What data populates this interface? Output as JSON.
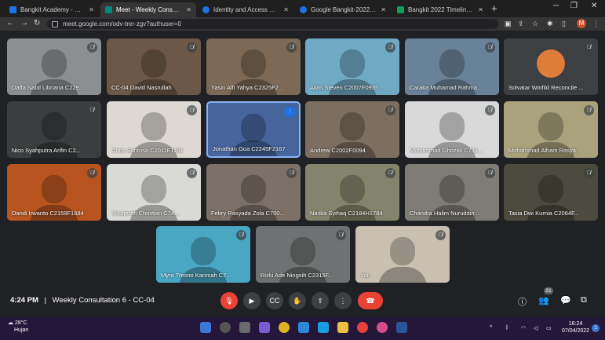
{
  "browser": {
    "tabs": [
      {
        "label": "Bangkit Academy - Calendar",
        "color": "#1a73e8",
        "active": false
      },
      {
        "label": "Meet - Weekly Consultation",
        "color": "#00897b",
        "active": true
      },
      {
        "label": "Identity and Access Manag...",
        "color": "#1a73e8",
        "active": false
      },
      {
        "label": "Google Bangkit-2022 | Cours",
        "color": "#1a73e8",
        "active": false
      },
      {
        "label": "Bangkit 2022 Timeline - Goo",
        "color": "#0f9d58",
        "active": false
      }
    ],
    "new_tab": "+",
    "url": "meet.google.com/odv-trer-zgv?authuser=0",
    "profile_initial": "M"
  },
  "participants": [
    {
      "name": "Daffa Nabil Libriana C229...",
      "bg": "#8c8f92"
    },
    {
      "name": "CC-04 David Nasrullah",
      "bg": "#6c5848"
    },
    {
      "name": "Yasin Alfi Yahya C2325F2...",
      "bg": "#7d6a56"
    },
    {
      "name": "Alvin Steven C2007F0935",
      "bg": "#6fa9c4"
    },
    {
      "name": "Caraka Muhamad Rahma...",
      "bg": "#6a8299"
    },
    {
      "name": "Solvatar Winfild Reconcile ...",
      "bg": "#3c4043"
    },
    {
      "name": "Nico Syahputra Arifin C2...",
      "bg": "#3b3d3e"
    },
    {
      "name": "Chris Santosa C2011F1181",
      "bg": "#ddd8d1"
    },
    {
      "name": "Jonathan Goa C2245F2167",
      "bg": "#46659c"
    },
    {
      "name": "Andrew C2002F0094",
      "bg": "#7c6e60"
    },
    {
      "name": "Muhammad Ghozali C731...",
      "bg": "#d8d8d8"
    },
    {
      "name": "Mohammad Alham Rasya...",
      "bg": "#a9a27c"
    },
    {
      "name": "Dandi Irwanto C2159F1684",
      "bg": "#b8541f"
    },
    {
      "name": "Anugerah Christian C74...",
      "bg": "#d9d9d6"
    },
    {
      "name": "Febry Rasyada Zola C700...",
      "bg": "#7c7067"
    },
    {
      "name": "Nadila Syihaq C2184H1784",
      "bg": "#84846c"
    },
    {
      "name": "Chandra Halim Nuruddin ...",
      "bg": "#7f7b75"
    },
    {
      "name": "Tasia Dwi Kurnia C2064F...",
      "bg": "#4d4a3e"
    },
    {
      "name": "Myra Tresno Karimah C7...",
      "bg": "#4aa7c4"
    },
    {
      "name": "Rizki Ade Ningsih C2315F...",
      "bg": "#6f7272"
    },
    {
      "name": "You",
      "bg": "#c9c0b2"
    }
  ],
  "meeting": {
    "time": "4:24 PM",
    "separator": "|",
    "title": "Weekly Consultation 6 - CC-04",
    "participant_count": "21"
  },
  "taskbar": {
    "temperature": "28°C",
    "condition": "Hujan",
    "time": "16:24",
    "date": "07/04/2022"
  }
}
